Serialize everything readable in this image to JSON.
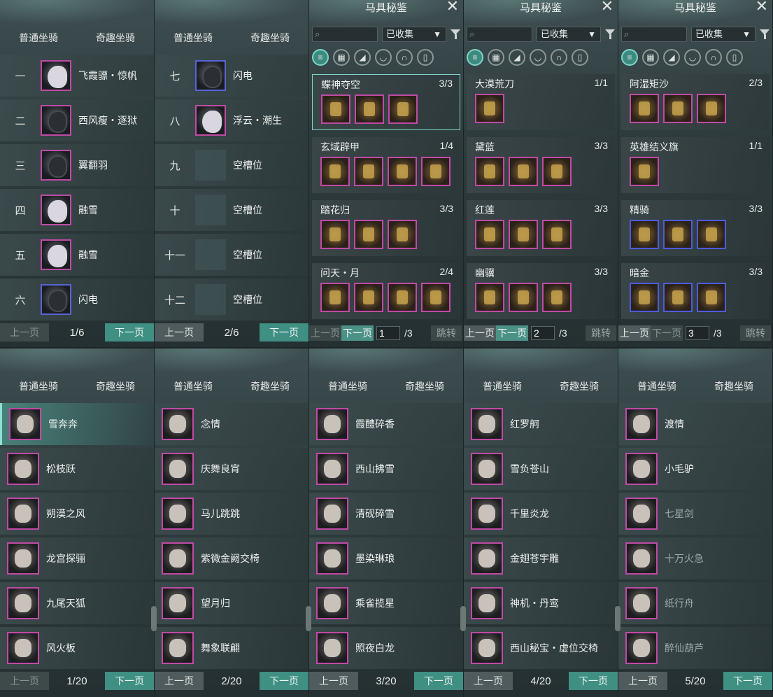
{
  "common": {
    "tab_normal": "普通坐骑",
    "tab_fun": "奇趣坐骑",
    "prev": "上一页",
    "next": "下一页"
  },
  "atlas": {
    "title": "马具秘鉴",
    "close": "✕",
    "filter_value": "已收集",
    "jump": "跳转",
    "search_icon": "⌕"
  },
  "top_panels": [
    {
      "page": "1/6",
      "rows": [
        {
          "num": "一",
          "name": "飞霞骠・惊帆",
          "frame": "pink",
          "color": "light"
        },
        {
          "num": "二",
          "name": "西风瘦・逐狱",
          "frame": "pink",
          "color": "dark"
        },
        {
          "num": "三",
          "name": "翼翻羽",
          "frame": "pink",
          "color": "dark"
        },
        {
          "num": "四",
          "name": "融雪",
          "frame": "pink",
          "color": "light"
        },
        {
          "num": "五",
          "name": "融雪",
          "frame": "pink",
          "color": "light"
        },
        {
          "num": "六",
          "name": "闪电",
          "frame": "blue",
          "color": "dark"
        }
      ]
    },
    {
      "page": "2/6",
      "rows": [
        {
          "num": "七",
          "name": "闪电",
          "frame": "blue",
          "color": "dark"
        },
        {
          "num": "八",
          "name": "浮云・潮生",
          "frame": "pink",
          "color": "light"
        },
        {
          "num": "九",
          "name": "空槽位",
          "frame": "empty",
          "color": "none"
        },
        {
          "num": "十",
          "name": "空槽位",
          "frame": "empty",
          "color": "none"
        },
        {
          "num": "十一",
          "name": "空槽位",
          "frame": "empty",
          "color": "none"
        },
        {
          "num": "十二",
          "name": "空槽位",
          "frame": "empty",
          "color": "none"
        }
      ]
    }
  ],
  "atlas_panels": [
    {
      "page_input": "1",
      "page_total": "/3",
      "sets": [
        {
          "title": "蝶神夺空",
          "count": "3/3",
          "items": [
            "pink",
            "pink",
            "pink"
          ],
          "selected": true
        },
        {
          "title": "玄域辟甲",
          "count": "1/4",
          "items": [
            "pink",
            "pink",
            "pink",
            "pink"
          ]
        },
        {
          "title": "踏花归",
          "count": "3/3",
          "items": [
            "pink",
            "pink",
            "pink"
          ]
        },
        {
          "title": "问天・月",
          "count": "2/4",
          "items": [
            "pink",
            "pink",
            "pink",
            "pink"
          ]
        }
      ]
    },
    {
      "page_input": "2",
      "page_total": "/3",
      "sets": [
        {
          "title": "大漠荒刀",
          "count": "1/1",
          "items": [
            "pink"
          ]
        },
        {
          "title": "黛蓝",
          "count": "3/3",
          "items": [
            "pink",
            "pink",
            "pink"
          ]
        },
        {
          "title": "红莲",
          "count": "3/3",
          "items": [
            "pink",
            "pink",
            "pink"
          ]
        },
        {
          "title": "幽骥",
          "count": "3/3",
          "items": [
            "pink",
            "pink",
            "pink"
          ]
        }
      ]
    },
    {
      "page_input": "3",
      "page_total": "/3",
      "sets": [
        {
          "title": "阿湿矩沙",
          "count": "2/3",
          "items": [
            "pink",
            "pink",
            "pink"
          ]
        },
        {
          "title": "英雄结义旗",
          "count": "1/1",
          "items": [
            "pink"
          ]
        },
        {
          "title": "精骑",
          "count": "3/3",
          "items": [
            "blue",
            "blue",
            "blue"
          ]
        },
        {
          "title": "暗金",
          "count": "3/3",
          "items": [
            "blue",
            "blue",
            "blue"
          ]
        }
      ]
    }
  ],
  "bottom_panels": [
    {
      "page": "1/20",
      "rows": [
        "雪奔奔",
        "松枝跃",
        "朔漠之风",
        "龙宫探骊",
        "九尾天狐",
        "风火板"
      ]
    },
    {
      "page": "2/20",
      "rows": [
        "念情",
        "庆舞良宵",
        "马儿跳跳",
        "紫微金阙交椅",
        "望月归",
        "舞象联翩"
      ]
    },
    {
      "page": "3/20",
      "rows": [
        "霞醴碎香",
        "西山拂雪",
        "清砚碎雪",
        "墨染琳琅",
        "乘雀揽星",
        "照夜白龙"
      ]
    },
    {
      "page": "4/20",
      "rows": [
        "红罗舸",
        "雪负苍山",
        "千里炎龙",
        "金翅苍宇雕",
        "神机・丹鸾",
        "西山秘宝・虚位交椅"
      ]
    },
    {
      "page": "5/20",
      "rows": [
        "渡情",
        "小毛驴",
        "七星剑",
        "十万火急",
        "纸行舟",
        "醉仙葫芦"
      ]
    }
  ],
  "dim_names": [
    "七星剑",
    "十万火急",
    "纸行舟",
    "醉仙葫芦"
  ]
}
